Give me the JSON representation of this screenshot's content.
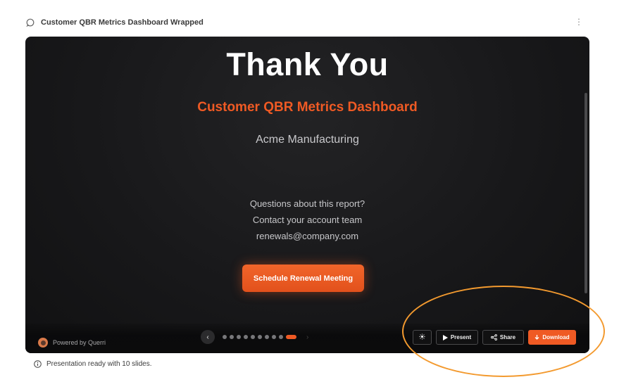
{
  "header": {
    "title": "Customer QBR Metrics Dashboard Wrapped",
    "menu_icon": "more-vertical-icon"
  },
  "slide": {
    "title": "Thank You",
    "subtitle": "Customer QBR Metrics Dashboard",
    "company": "Acme Manufacturing",
    "contact_lines": [
      "Questions about this report?",
      "Contact your account team",
      "renewals@company.com"
    ],
    "cta_label": "Schedule Renewal Meeting"
  },
  "footer": {
    "powered_by": "Powered by Querri",
    "slide_count": 10,
    "current_slide": 10,
    "buttons": {
      "theme_icon": "sun-icon",
      "present": "Present",
      "share": "Share",
      "download": "Download"
    }
  },
  "status": {
    "text": "Presentation ready with 10 slides."
  },
  "colors": {
    "accent": "#ef5a24",
    "slide_bg": "#18181a",
    "annotation": "#f39a2f"
  }
}
